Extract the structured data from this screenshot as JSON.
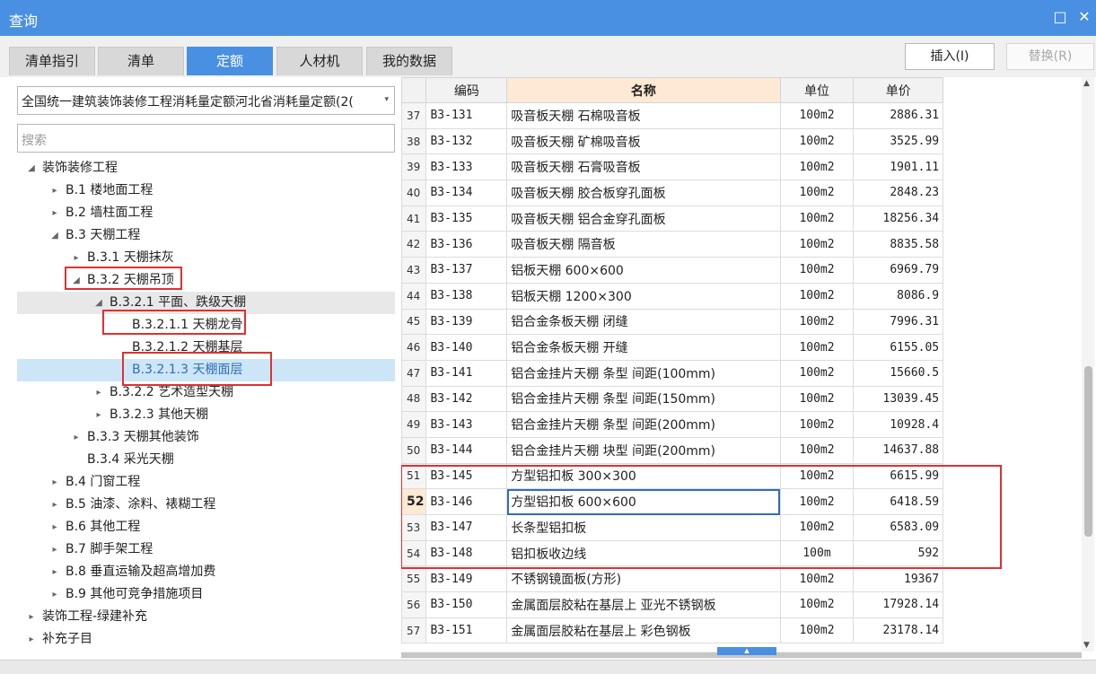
{
  "window": {
    "title": "查询",
    "maximize_glyph": "□",
    "close_glyph": "✕"
  },
  "tabs": [
    "清单指引",
    "清单",
    "定额",
    "人材机",
    "我的数据"
  ],
  "active_tab": 2,
  "actions": {
    "insert": "插入(I)",
    "replace": "替换(R)"
  },
  "combo": {
    "value": "全国统一建筑装饰装修工程消耗量定额河北省消耗量定额(2(",
    "arrow": "▾"
  },
  "search": {
    "placeholder": "搜索"
  },
  "tree": [
    {
      "label": "装饰装修工程",
      "level": 0,
      "toggle": "◢",
      "hl": ""
    },
    {
      "label": "B.1 楼地面工程",
      "level": 1,
      "toggle": "▸",
      "hl": ""
    },
    {
      "label": "B.2 墙柱面工程",
      "level": 1,
      "toggle": "▸",
      "hl": ""
    },
    {
      "label": "B.3 天棚工程",
      "level": 1,
      "toggle": "◢",
      "hl": ""
    },
    {
      "label": "B.3.1 天棚抹灰",
      "level": 2,
      "toggle": "▸",
      "hl": ""
    },
    {
      "label": "B.3.2 天棚吊顶",
      "level": 2,
      "toggle": "◢",
      "hl": ""
    },
    {
      "label": "B.3.2.1 平面、跌级天棚",
      "level": 3,
      "toggle": "◢",
      "hl": "gray"
    },
    {
      "label": "B.3.2.1.1 天棚龙骨",
      "level": 4,
      "toggle": "",
      "hl": ""
    },
    {
      "label": "B.3.2.1.2 天棚基层",
      "level": 4,
      "toggle": "",
      "hl": ""
    },
    {
      "label": "B.3.2.1.3 天棚面层",
      "level": 4,
      "toggle": "",
      "hl": "blue"
    },
    {
      "label": "B.3.2.2 艺术造型天棚",
      "level": 3,
      "toggle": "▸",
      "hl": ""
    },
    {
      "label": "B.3.2.3 其他天棚",
      "level": 3,
      "toggle": "▸",
      "hl": ""
    },
    {
      "label": "B.3.3 天棚其他装饰",
      "level": 2,
      "toggle": "▸",
      "hl": ""
    },
    {
      "label": "B.3.4 采光天棚",
      "level": 2,
      "toggle": "",
      "hl": ""
    },
    {
      "label": "B.4 门窗工程",
      "level": 1,
      "toggle": "▸",
      "hl": ""
    },
    {
      "label": "B.5 油漆、涂料、裱糊工程",
      "level": 1,
      "toggle": "▸",
      "hl": ""
    },
    {
      "label": "B.6 其他工程",
      "level": 1,
      "toggle": "▸",
      "hl": ""
    },
    {
      "label": "B.7 脚手架工程",
      "level": 1,
      "toggle": "▸",
      "hl": ""
    },
    {
      "label": "B.8 垂直运输及超高增加费",
      "level": 1,
      "toggle": "▸",
      "hl": ""
    },
    {
      "label": "B.9 其他可竞争措施项目",
      "level": 1,
      "toggle": "▸",
      "hl": ""
    },
    {
      "label": "装饰工程-绿建补充",
      "level": 0,
      "toggle": "▸",
      "hl": ""
    },
    {
      "label": "补充子目",
      "level": 0,
      "toggle": "▸",
      "hl": ""
    }
  ],
  "table": {
    "headers": [
      "编码",
      "名称",
      "单位",
      "单价"
    ],
    "current_row": "52",
    "rows": [
      [
        "37",
        "B3-131",
        "吸音板天棚 石棉吸音板",
        "100m2",
        "2886.31"
      ],
      [
        "38",
        "B3-132",
        "吸音板天棚 矿棉吸音板",
        "100m2",
        "3525.99"
      ],
      [
        "39",
        "B3-133",
        "吸音板天棚 石膏吸音板",
        "100m2",
        "1901.11"
      ],
      [
        "40",
        "B3-134",
        "吸音板天棚 胶合板穿孔面板",
        "100m2",
        "2848.23"
      ],
      [
        "41",
        "B3-135",
        "吸音板天棚 铝合金穿孔面板",
        "100m2",
        "18256.34"
      ],
      [
        "42",
        "B3-136",
        "吸音板天棚 隔音板",
        "100m2",
        "8835.58"
      ],
      [
        "43",
        "B3-137",
        "铝板天棚 600×600",
        "100m2",
        "6969.79"
      ],
      [
        "44",
        "B3-138",
        "铝板天棚 1200×300",
        "100m2",
        "8086.9"
      ],
      [
        "45",
        "B3-139",
        "铝合金条板天棚 闭缝",
        "100m2",
        "7996.31"
      ],
      [
        "46",
        "B3-140",
        "铝合金条板天棚 开缝",
        "100m2",
        "6155.05"
      ],
      [
        "47",
        "B3-141",
        "铝合金挂片天棚 条型 间距(100mm)",
        "100m2",
        "15660.5"
      ],
      [
        "48",
        "B3-142",
        "铝合金挂片天棚 条型 间距(150mm)",
        "100m2",
        "13039.45"
      ],
      [
        "49",
        "B3-143",
        "铝合金挂片天棚 条型 间距(200mm)",
        "100m2",
        "10928.4"
      ],
      [
        "50",
        "B3-144",
        "铝合金挂片天棚 块型 间距(200mm)",
        "100m2",
        "14637.88"
      ],
      [
        "51",
        "B3-145",
        "方型铝扣板 300×300",
        "100m2",
        "6615.99"
      ],
      [
        "52",
        "B3-146",
        "方型铝扣板 600×600",
        "100m2",
        "6418.59"
      ],
      [
        "53",
        "B3-147",
        "长条型铝扣板",
        "100m2",
        "6583.09"
      ],
      [
        "54",
        "B3-148",
        "铝扣板收边线",
        "100m",
        "592"
      ],
      [
        "55",
        "B3-149",
        "不锈钢镜面板(方形)",
        "100m2",
        "19367"
      ],
      [
        "56",
        "B3-150",
        "金属面层胶粘在基层上 亚光不锈钢板",
        "100m2",
        "17928.14"
      ],
      [
        "57",
        "B3-151",
        "金属面层胶粘在基层上 彩色钢板",
        "100m2",
        "23178.14"
      ]
    ]
  },
  "scroll": {
    "up": "▲",
    "down": "▼",
    "grip": "▲"
  }
}
